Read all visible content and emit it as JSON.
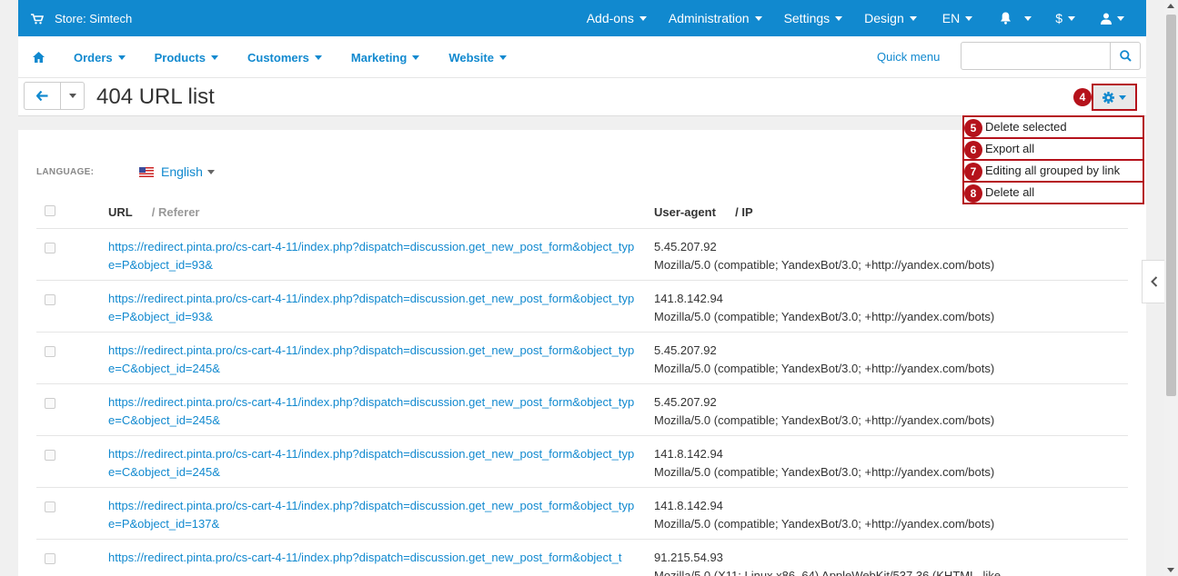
{
  "topbar": {
    "store": "Store: Simtech",
    "menu": [
      "Add-ons",
      "Administration",
      "Settings",
      "Design",
      "EN",
      "",
      "$",
      ""
    ]
  },
  "navbar": {
    "items": [
      "Orders",
      "Products",
      "Customers",
      "Marketing",
      "Website"
    ],
    "quick_menu": "Quick menu",
    "search_placeholder": ""
  },
  "page": {
    "title": "404 URL list"
  },
  "language": {
    "label": "LANGUAGE:",
    "value": "English"
  },
  "table": {
    "headers": {
      "url": "URL",
      "referer": "/ Referer",
      "user_agent": "User-agent",
      "ip": "/ IP"
    },
    "rows": [
      {
        "url": "https://redirect.pinta.pro/cs-cart-4-11/index.php?dispatch=discussion.get_new_post_form&object_type=P&object_id=93&",
        "ip": "5.45.207.92",
        "ua": "Mozilla/5.0 (compatible; YandexBot/3.0; +http://yandex.com/bots)"
      },
      {
        "url": "https://redirect.pinta.pro/cs-cart-4-11/index.php?dispatch=discussion.get_new_post_form&object_type=P&object_id=93&",
        "ip": "141.8.142.94",
        "ua": "Mozilla/5.0 (compatible; YandexBot/3.0; +http://yandex.com/bots)"
      },
      {
        "url": "https://redirect.pinta.pro/cs-cart-4-11/index.php?dispatch=discussion.get_new_post_form&object_type=C&object_id=245&",
        "ip": "5.45.207.92",
        "ua": "Mozilla/5.0 (compatible; YandexBot/3.0; +http://yandex.com/bots)"
      },
      {
        "url": "https://redirect.pinta.pro/cs-cart-4-11/index.php?dispatch=discussion.get_new_post_form&object_type=C&object_id=245&",
        "ip": "5.45.207.92",
        "ua": "Mozilla/5.0 (compatible; YandexBot/3.0; +http://yandex.com/bots)"
      },
      {
        "url": "https://redirect.pinta.pro/cs-cart-4-11/index.php?dispatch=discussion.get_new_post_form&object_type=C&object_id=245&",
        "ip": "141.8.142.94",
        "ua": "Mozilla/5.0 (compatible; YandexBot/3.0; +http://yandex.com/bots)"
      },
      {
        "url": "https://redirect.pinta.pro/cs-cart-4-11/index.php?dispatch=discussion.get_new_post_form&object_type=P&object_id=137&",
        "ip": "141.8.142.94",
        "ua": "Mozilla/5.0 (compatible; YandexBot/3.0; +http://yandex.com/bots)"
      },
      {
        "url": "https://redirect.pinta.pro/cs-cart-4-11/index.php?dispatch=discussion.get_new_post_form&object_t",
        "ip": "91.215.54.93",
        "ua": "Mozilla/5.0 (X11; Linux x86_64) AppleWebKit/537.36 (KHTML, like"
      }
    ]
  },
  "dropdown": {
    "gear_badge": "4",
    "items": [
      {
        "badge": "5",
        "label": "Delete selected"
      },
      {
        "badge": "6",
        "label": "Export all"
      },
      {
        "badge": "7",
        "label": "Editing all grouped by link"
      },
      {
        "badge": "8",
        "label": "Delete all"
      }
    ]
  },
  "colors": {
    "accent": "#1189cf",
    "annotation": "#b5121b"
  }
}
